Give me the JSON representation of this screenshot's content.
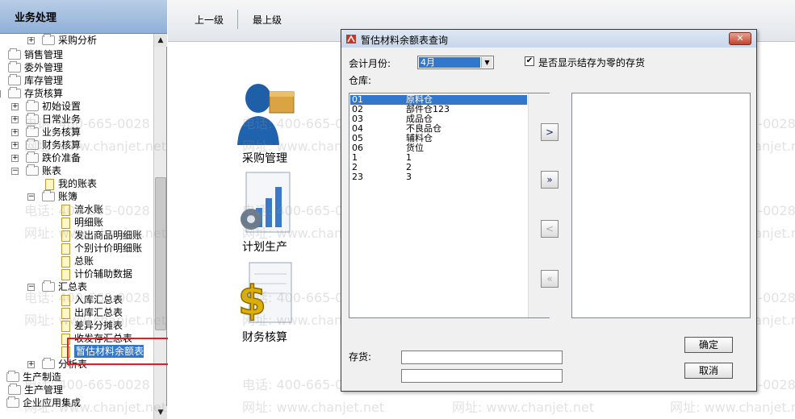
{
  "tree": {
    "header": "业务处理",
    "items": [
      {
        "label": "采购分析"
      },
      {
        "label": "销售管理"
      },
      {
        "label": "委外管理"
      },
      {
        "label": "库存管理"
      },
      {
        "label": "存货核算"
      },
      {
        "label": "初始设置"
      },
      {
        "label": "日常业务"
      },
      {
        "label": "业务核算"
      },
      {
        "label": "财务核算"
      },
      {
        "label": "跌价准备"
      },
      {
        "label": "账表"
      },
      {
        "label": "我的账表"
      },
      {
        "label": "账簿"
      },
      {
        "label": "流水账"
      },
      {
        "label": "明细账"
      },
      {
        "label": "发出商品明细账"
      },
      {
        "label": "个别计价明细账"
      },
      {
        "label": "总账"
      },
      {
        "label": "计价辅助数据"
      },
      {
        "label": "汇总表"
      },
      {
        "label": "入库汇总表"
      },
      {
        "label": "出库汇总表"
      },
      {
        "label": "差异分摊表"
      },
      {
        "label": "收发存汇总表"
      },
      {
        "label": "暂估材料余额表"
      },
      {
        "label": "分析表"
      },
      {
        "label": "生产制造"
      },
      {
        "label": "生产管理"
      },
      {
        "label": "企业应用集成"
      }
    ]
  },
  "toolbar": {
    "up_label": "上一级",
    "top_label": "最上级"
  },
  "modules": [
    {
      "label": "采购管理"
    },
    {
      "label": "计划生产"
    },
    {
      "label": "财务核算"
    }
  ],
  "dialog": {
    "title": "暂估材料余额表查询",
    "close": "✕",
    "month_label": "会计月份:",
    "month_value": "4月",
    "show_zero_label": "是否显示结存为零的存货",
    "show_zero_checked": true,
    "warehouse_label": "仓库:",
    "warehouses": [
      {
        "code": "01",
        "name": "原料仓"
      },
      {
        "code": "02",
        "name": "部件仓123"
      },
      {
        "code": "03",
        "name": "成品仓"
      },
      {
        "code": "04",
        "name": "不良品仓"
      },
      {
        "code": "05",
        "name": "辅料仓"
      },
      {
        "code": "06",
        "name": "货位"
      },
      {
        "code": "1",
        "name": "1"
      },
      {
        "code": "2",
        "name": "2"
      },
      {
        "code": "23",
        "name": "3"
      }
    ],
    "btn_add": ">",
    "btn_add_all": "»",
    "btn_remove": "<",
    "btn_remove_all": "«",
    "inventory_label": "存货:",
    "ok_label": "确定",
    "cancel_label": "取消"
  },
  "watermark": {
    "phone": "电话: 400-665-0028",
    "site": "网址: www.chanjet.net"
  },
  "colors": {
    "selection": "#3377cc",
    "highlight_box": "#e02020"
  }
}
